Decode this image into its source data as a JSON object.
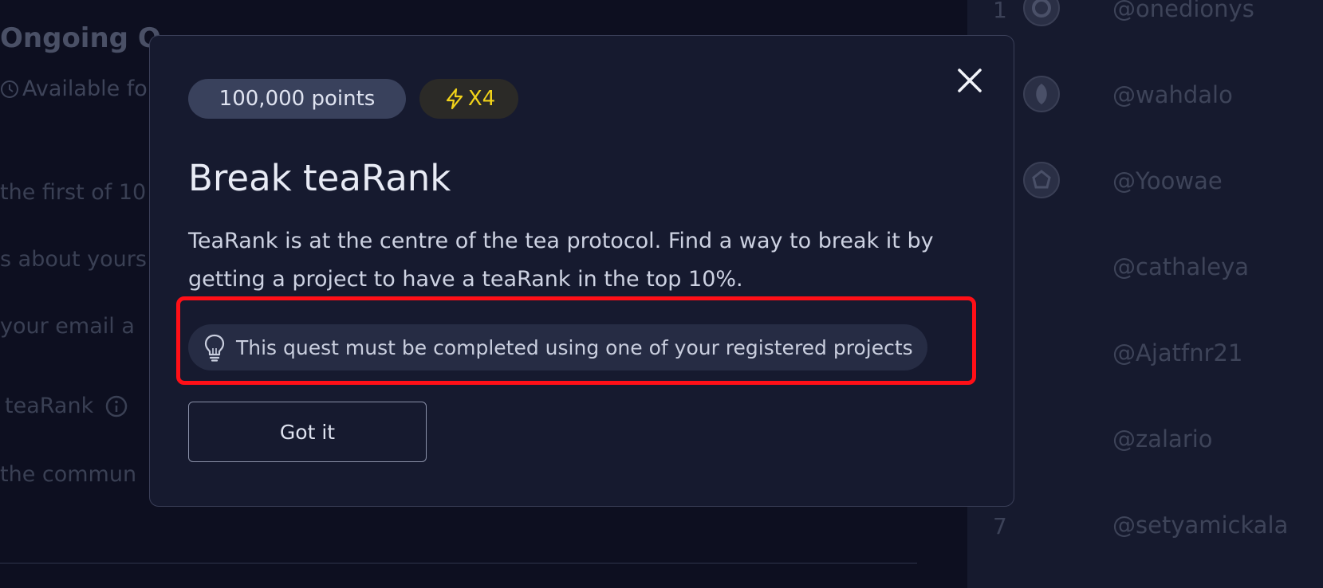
{
  "background": {
    "title": "Ongoing Q",
    "subtitle": "Available fo",
    "rows": [
      "the first of 10",
      "s about yours",
      " your email a",
      "teaRank",
      "the commun"
    ],
    "leaderboard": [
      {
        "rank": "1",
        "handle": "@onedionys",
        "avatar": "avatar-icon"
      },
      {
        "rank": "",
        "handle": "@wahdalo",
        "avatar": "avatar-icon"
      },
      {
        "rank": "",
        "handle": "@Yoowae",
        "avatar": "avatar-icon"
      },
      {
        "rank": "",
        "handle": "@cathaleya"
      },
      {
        "rank": "",
        "handle": "@Ajatfnr21"
      },
      {
        "rank": "",
        "handle": "@zalario"
      },
      {
        "rank": "7",
        "handle": "@setyamickala"
      }
    ]
  },
  "modal": {
    "points_label": "100,000 points",
    "multiplier_label": "X4",
    "title": "Break teaRank",
    "description": "TeaRank is at the centre of the tea protocol. Find a way to break it by getting a project to have a teaRank in the top 10%.",
    "hint": "This quest must be completed using one of your registered projects",
    "button_label": "Got it",
    "close_icon": "close-icon"
  },
  "colors": {
    "highlight": "#ff0f17",
    "multiplier": "#f1d21a",
    "modal_bg": "#161a2f"
  }
}
